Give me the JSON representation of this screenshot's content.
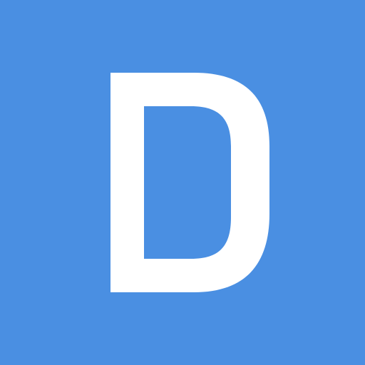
{
  "icon": {
    "name": "letter-d-icon",
    "letter": "D",
    "background_color": "#4a8fe2",
    "foreground_color": "#ffffff"
  }
}
